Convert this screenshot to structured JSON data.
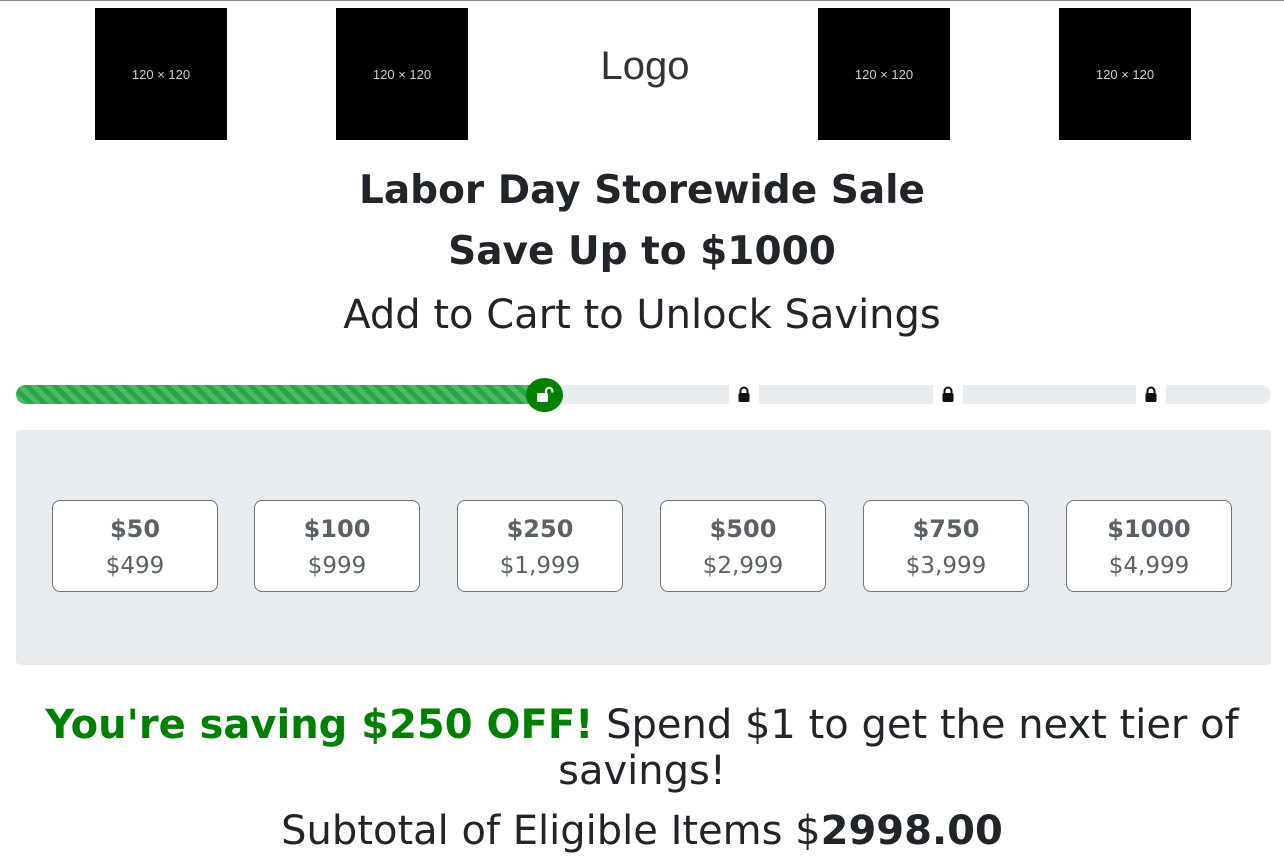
{
  "header": {
    "placeholders": [
      "120 × 120",
      "120 × 120",
      "120 × 120",
      "120 × 120"
    ],
    "logo_text": "Logo"
  },
  "promo": {
    "title": "Labor Day Storewide Sale",
    "subtitle": "Save Up to $1000",
    "cta": "Add to Cart to Unlock Savings"
  },
  "progress": {
    "filled_fraction": 0.43,
    "milestone_icons": [
      "unlocked-lock-icon",
      "lock-icon",
      "lock-icon",
      "lock-icon"
    ],
    "fill_color": "#28a745",
    "unlocked_color": "#008000"
  },
  "tiers": [
    {
      "discount": "$50",
      "threshold": "$499"
    },
    {
      "discount": "$100",
      "threshold": "$999"
    },
    {
      "discount": "$250",
      "threshold": "$1,999"
    },
    {
      "discount": "$500",
      "threshold": "$2,999"
    },
    {
      "discount": "$750",
      "threshold": "$3,999"
    },
    {
      "discount": "$1000",
      "threshold": "$4,999"
    }
  ],
  "status": {
    "saving_text": "You're saving $250 OFF!",
    "next_tier_text": " Spend $1 to get the next tier of savings!",
    "subtotal_label": "Subtotal of Eligible Items $",
    "subtotal_value": "2998.00"
  }
}
